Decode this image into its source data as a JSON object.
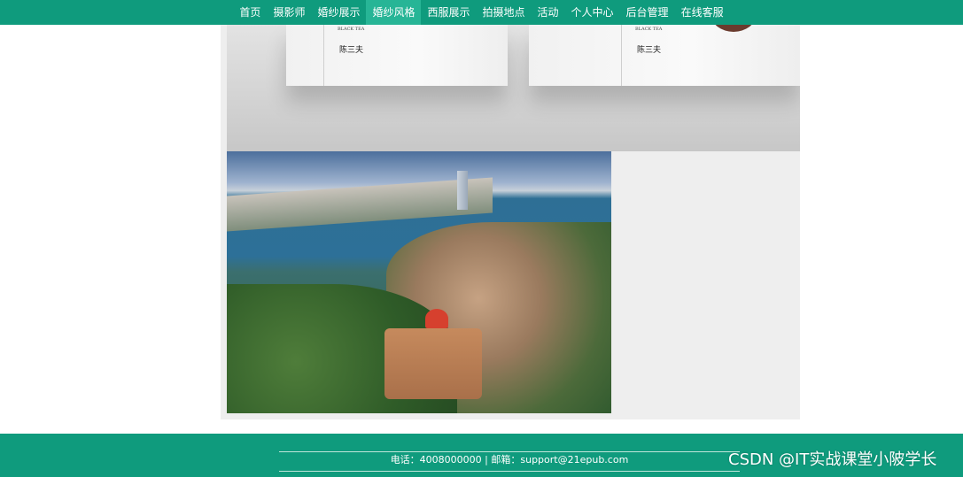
{
  "nav": {
    "items": [
      {
        "label": "首页"
      },
      {
        "label": "摄影师"
      },
      {
        "label": "婚纱展示"
      },
      {
        "label": "婚纱风格"
      },
      {
        "label": "西服展示"
      },
      {
        "label": "拍摄地点"
      },
      {
        "label": "活动"
      },
      {
        "label": "个人中心"
      },
      {
        "label": "后台管理"
      },
      {
        "label": "在线客服"
      }
    ],
    "active_index": 3
  },
  "product_photo": {
    "box_text": "BLACK TEA",
    "box_mark": "陈三夫"
  },
  "footer": {
    "contact": "电话：4008000000 | 邮箱：support@21epub.com"
  },
  "watermark": "CSDN @IT实战课堂小陂学长",
  "colors": {
    "brand": "#0f9b7d",
    "nav_active": "#27b596"
  }
}
